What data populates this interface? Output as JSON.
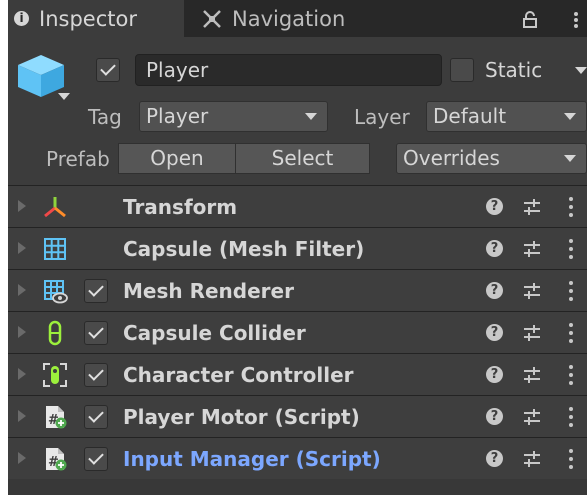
{
  "tabs": {
    "inspector": "Inspector",
    "navigation": "Navigation"
  },
  "header": {
    "name": "Player",
    "static_label": "Static",
    "active_checked": true,
    "static_checked": false,
    "tag_label": "Tag",
    "tag_value": "Player",
    "layer_label": "Layer",
    "layer_value": "Default",
    "prefab_label": "Prefab",
    "open_label": "Open",
    "select_label": "Select",
    "overrides_label": "Overrides"
  },
  "components": [
    {
      "name": "Transform",
      "icon": "transform-icon",
      "has_checkbox": false
    },
    {
      "name": "Capsule (Mesh Filter)",
      "icon": "mesh-filter-icon",
      "has_checkbox": false
    },
    {
      "name": "Mesh Renderer",
      "icon": "mesh-renderer-icon",
      "has_checkbox": true,
      "checked": true
    },
    {
      "name": "Capsule Collider",
      "icon": "capsule-collider-icon",
      "has_checkbox": true,
      "checked": true
    },
    {
      "name": "Character Controller",
      "icon": "character-controller-icon",
      "has_checkbox": true,
      "checked": true
    },
    {
      "name": "Player Motor (Script)",
      "icon": "script-icon",
      "has_checkbox": true,
      "checked": true
    },
    {
      "name": "Input Manager (Script)",
      "icon": "script-icon",
      "has_checkbox": true,
      "checked": true,
      "highlight": true
    }
  ],
  "colors": {
    "panel_bg": "#383838",
    "accent_link": "#7ca7ff",
    "cube_blue": "#5fc3f5",
    "green_icon": "#9cf03c"
  }
}
